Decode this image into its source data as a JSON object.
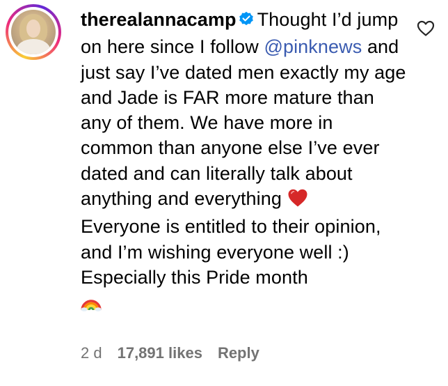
{
  "comment": {
    "username": "therealannacamp",
    "verified": true,
    "text_start": "Thought I’d jump on here since I follow",
    "mention": "@pinknews",
    "text_middle": "and just say I’ve dated men exactly my age and Jade is FAR more mature than any of them. We have more in common than anyone else I’ve ever dated and can literally talk about anything and everything",
    "heart_emoji": "red-heart",
    "text_end": "Everyone is entitled to their opinion, and I’m wishing everyone well :) Especially this Pride month",
    "rainbow_emoji": "rainbow",
    "time": "2 d",
    "likes": "17,891 likes",
    "reply_label": "Reply"
  },
  "icons": {
    "like": "heart-outline-icon",
    "verified": "verified-badge-icon"
  },
  "colors": {
    "mention": "#3a5bb0",
    "verified": "#0095f6",
    "meta": "#737373",
    "heart_emoji": "#d62828"
  }
}
